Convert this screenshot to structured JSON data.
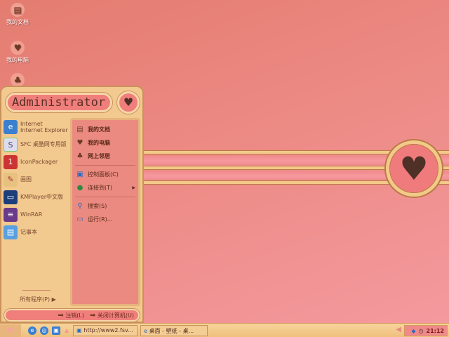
{
  "desktop": {
    "icons": [
      {
        "label": "我的文档",
        "icon": "documents-icon"
      },
      {
        "label": "我的电脑",
        "icon": "heart-computer-icon"
      },
      {
        "label": "",
        "icon": "network-icon"
      }
    ]
  },
  "start_menu": {
    "user": "Administrator",
    "pinned": [
      {
        "title": "Internet",
        "subtitle": "Internet Explorer"
      },
      {
        "title": "SFC 桌酷网专用版"
      },
      {
        "title": "IconPackager"
      },
      {
        "title": "画图"
      },
      {
        "title": "KMPlayer中文版"
      },
      {
        "title": "WinRAR"
      },
      {
        "title": "记事本"
      }
    ],
    "all_programs": "所有程序(P)",
    "places": [
      "我的文档",
      "我的电脑",
      "网上邻居"
    ],
    "system": [
      "控制面板(C)",
      "连接到(T)"
    ],
    "tools": [
      "搜索(S)",
      "运行(R)..."
    ],
    "logoff": "注销(L)",
    "shutdown": "关闭计算机(U)"
  },
  "taskbar": {
    "tasks": [
      "http://www2.fsv...",
      "桌面 - 壁纸 - 桌..."
    ],
    "clock": "21:12"
  },
  "colors": {
    "background": "#ec8a84",
    "menu": "#f2c98e",
    "accent": "#f07f7c",
    "heart": "#4e3027"
  }
}
